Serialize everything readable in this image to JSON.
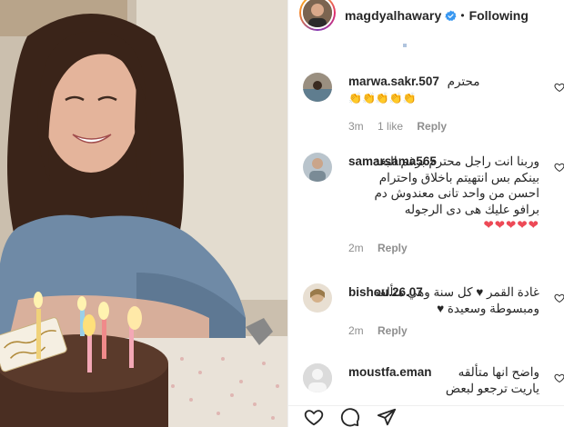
{
  "header": {
    "username": "magdyalhawary",
    "separator": "•",
    "follow_status": "Following"
  },
  "comments": [
    {
      "username": "marwa.sakr.507",
      "text": "محترم",
      "emoji": "👏👏👏👏👏",
      "time": "3m",
      "likes": "1 like",
      "reply": "Reply"
    },
    {
      "username": "samarsama565",
      "text": "وربنا انت راجل محترم برغم البعد بينكم بس انتهيتم باخلاق واحترام احسن من واحد تانى معندوش دم برافو عليك هى دى الرجوله",
      "emoji": "❤❤❤❤❤",
      "time": "2m",
      "reply": "Reply"
    },
    {
      "username": "bishou.26.07",
      "text": "غادة القمر ♥ كل سنة وهي متألقة ومبسوطة وسعيدة ♥",
      "time": "2m",
      "reply": "Reply"
    },
    {
      "username": "moustfa.eman",
      "text": "واضح انها متألقه",
      "text2": "ياريت ترجعو لبعض"
    }
  ],
  "icons": {
    "verified": "verified-badge-icon",
    "like": "heart-outline-icon",
    "comment": "comment-bubble-icon",
    "share": "paper-plane-icon"
  },
  "colors": {
    "verified_blue": "#3897f0",
    "meta_gray": "#8e8e8e",
    "heart_red": "#ed4956"
  }
}
